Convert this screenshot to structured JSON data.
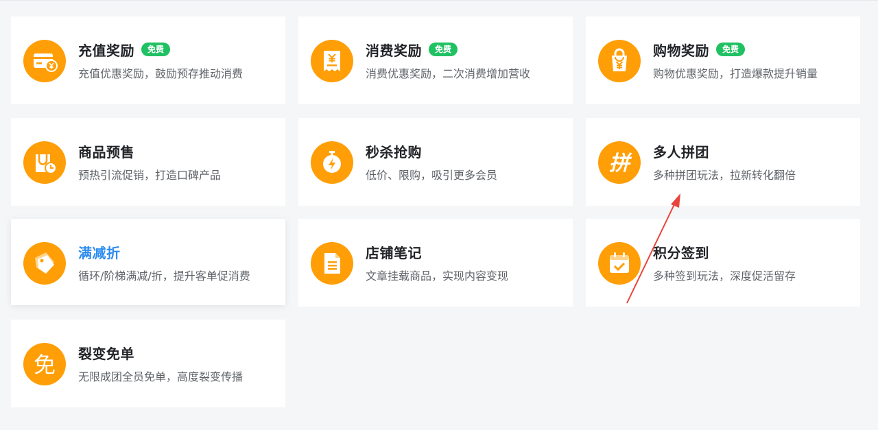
{
  "colors": {
    "page_bg": "#f5f6f8",
    "card_bg": "#ffffff",
    "icon_bg": "#ff9e06",
    "badge_bg": "#20c163",
    "active_title": "#2d8cf0",
    "arrow": "#e8453c"
  },
  "cards": [
    {
      "title": "充值奖励",
      "badge": "免费",
      "desc": "充值优惠奖励，鼓励预存推动消费",
      "icon": "card-yuan-icon"
    },
    {
      "title": "消费奖励",
      "badge": "免费",
      "desc": "消费优惠奖励，二次消费增加营收",
      "icon": "receipt-yuan-icon"
    },
    {
      "title": "购物奖励",
      "badge": "免费",
      "desc": "购物优惠奖励，打造爆款提升销量",
      "icon": "bag-yuan-icon"
    },
    {
      "title": "商品预售",
      "badge": "",
      "desc": "预热引流促销，打造口碑产品",
      "icon": "bag-clock-icon"
    },
    {
      "title": "秒杀抢购",
      "badge": "",
      "desc": "低价、限购，吸引更多会员",
      "icon": "stopwatch-lightning-icon"
    },
    {
      "title": "多人拼团",
      "badge": "",
      "desc": "多种拼团玩法，拉新转化翻倍",
      "icon": "pin-character-icon"
    },
    {
      "title": "满减折",
      "badge": "",
      "desc": "循环/阶梯满减/折，提升客单促消费",
      "icon": "price-tag-icon"
    },
    {
      "title": "店铺笔记",
      "badge": "",
      "desc": "文章挂载商品，实现内容变现",
      "icon": "document-icon"
    },
    {
      "title": "积分签到",
      "badge": "",
      "desc": "多种签到玩法，深度促活留存",
      "icon": "calendar-check-icon"
    },
    {
      "title": "裂变免单",
      "badge": "",
      "desc": "无限成团全员免单，高度裂变传播",
      "icon": "mian-character-icon"
    }
  ],
  "pin_glyph": "拼",
  "mian_glyph": "免"
}
